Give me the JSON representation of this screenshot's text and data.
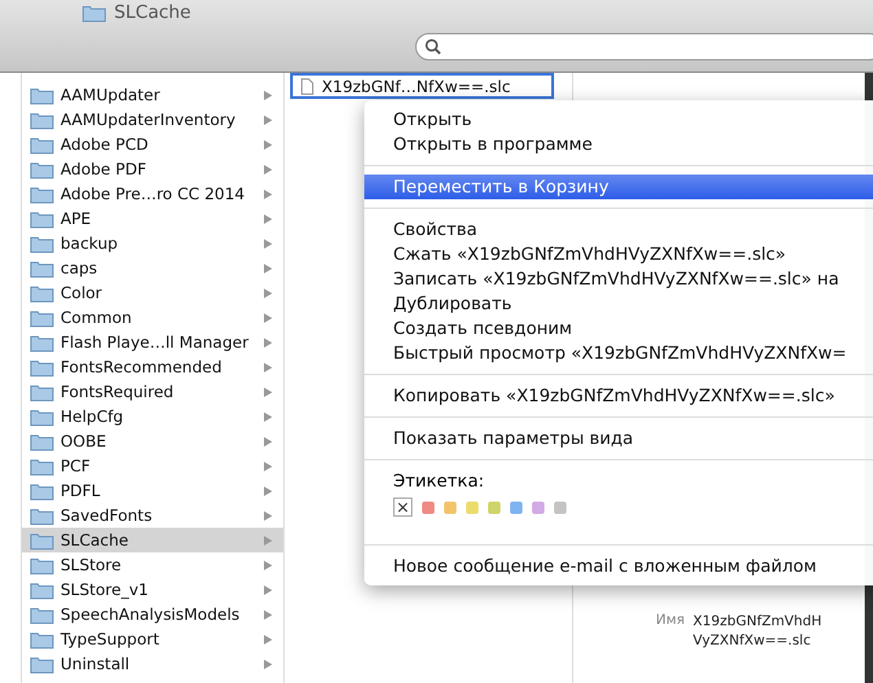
{
  "window": {
    "title": "SLCache"
  },
  "folders": [
    {
      "name": "AAMUpdater",
      "selected": false
    },
    {
      "name": "AAMUpdaterInventory",
      "selected": false
    },
    {
      "name": "Adobe PCD",
      "selected": false
    },
    {
      "name": "Adobe PDF",
      "selected": false
    },
    {
      "name": "Adobe Pre…ro CC 2014",
      "selected": false
    },
    {
      "name": "APE",
      "selected": false
    },
    {
      "name": "backup",
      "selected": false
    },
    {
      "name": "caps",
      "selected": false
    },
    {
      "name": "Color",
      "selected": false
    },
    {
      "name": "Common",
      "selected": false
    },
    {
      "name": "Flash Playe…ll Manager",
      "selected": false
    },
    {
      "name": "FontsRecommended",
      "selected": false
    },
    {
      "name": "FontsRequired",
      "selected": false
    },
    {
      "name": "HelpCfg",
      "selected": false
    },
    {
      "name": "OOBE",
      "selected": false
    },
    {
      "name": "PCF",
      "selected": false
    },
    {
      "name": "PDFL",
      "selected": false
    },
    {
      "name": "SavedFonts",
      "selected": false
    },
    {
      "name": "SLCache",
      "selected": true
    },
    {
      "name": "SLStore",
      "selected": false
    },
    {
      "name": "SLStore_v1",
      "selected": false
    },
    {
      "name": "SpeechAnalysisModels",
      "selected": false
    },
    {
      "name": "TypeSupport",
      "selected": false
    },
    {
      "name": "Uninstall",
      "selected": false
    }
  ],
  "file": {
    "name": "X19zbGNf…NfXw==.slc",
    "selected": true
  },
  "context_menu": {
    "groups": [
      {
        "items": [
          {
            "label": "Открыть",
            "selected": false
          },
          {
            "label": "Открыть в программе",
            "selected": false
          }
        ]
      },
      {
        "items": [
          {
            "label": "Переместить в Корзину",
            "selected": true
          }
        ]
      },
      {
        "items": [
          {
            "label": "Свойства",
            "selected": false
          },
          {
            "label": "Сжать «X19zbGNfZmVhdHVyZXNfXw==.slc»",
            "selected": false
          },
          {
            "label": "Записать «X19zbGNfZmVhdHVyZXNfXw==.slc» на",
            "selected": false
          },
          {
            "label": "Дублировать",
            "selected": false
          },
          {
            "label": "Создать псевдоним",
            "selected": false
          },
          {
            "label": "Быстрый просмотр «X19zbGNfZmVhdHVyZXNfXw=",
            "selected": false
          }
        ]
      },
      {
        "items": [
          {
            "label": "Копировать «X19zbGNfZmVhdHVyZXNfXw==.slc»",
            "selected": false
          }
        ]
      },
      {
        "items": [
          {
            "label": "Показать параметры вида",
            "selected": false
          }
        ]
      }
    ],
    "label_section": {
      "title": "Этикетка:",
      "swatches": [
        {
          "kind": "none",
          "symbol": "×"
        },
        {
          "kind": "color",
          "color": "#f08a84"
        },
        {
          "kind": "color",
          "color": "#f2c46a"
        },
        {
          "kind": "color",
          "color": "#ecdc6c"
        },
        {
          "kind": "color",
          "color": "#cfd46a"
        },
        {
          "kind": "color",
          "color": "#7fb4f2"
        },
        {
          "kind": "color",
          "color": "#d2aae6"
        },
        {
          "kind": "color",
          "color": "#c4c4c4"
        }
      ]
    },
    "footer_items": [
      {
        "label": "Новое сообщение e-mail с вложенным файлом",
        "selected": false
      }
    ]
  },
  "preview": {
    "fields": [
      {
        "label": "Имя",
        "value": "X19zbGNfZmVhdHVyZXNfXw==.slc"
      }
    ]
  }
}
